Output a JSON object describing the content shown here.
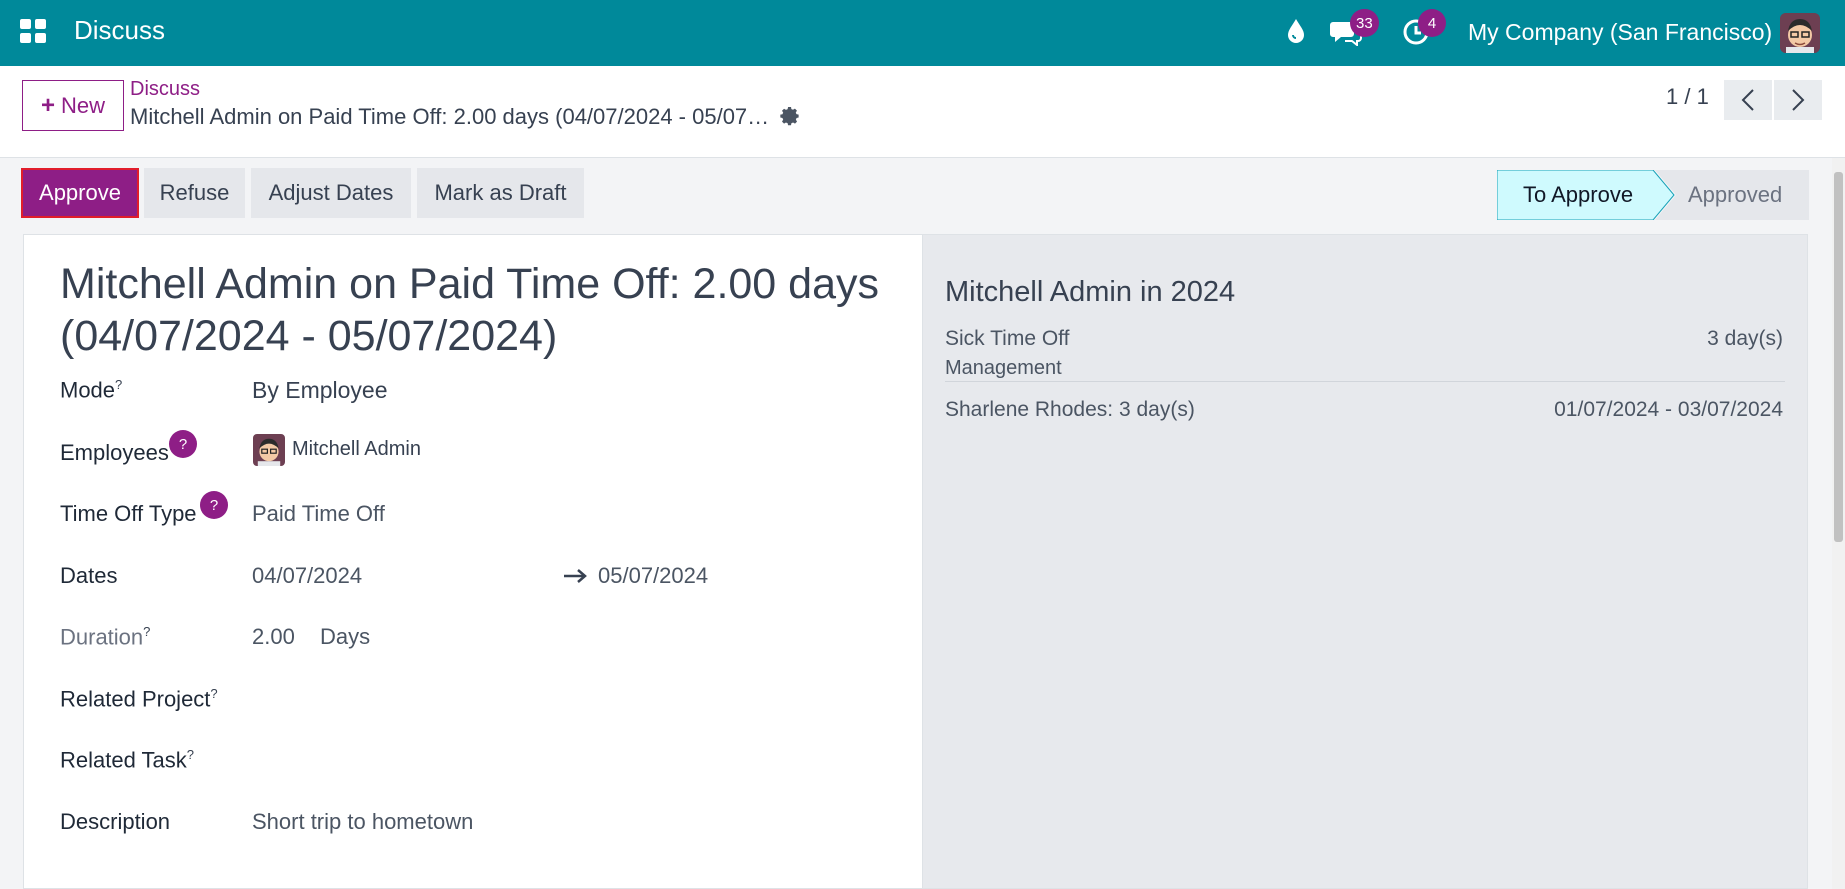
{
  "navbar": {
    "app_title": "Discuss",
    "messages_count": "33",
    "activities_count": "4",
    "company": "My Company (San Francisco)",
    "accent": "#00899a",
    "badge_color": "#8e1e86"
  },
  "control": {
    "new_label": "New",
    "breadcrumb_parent": "Discuss",
    "breadcrumb_current": "Mitchell Admin on Paid Time Off: 2.00 days (04/07/2024 - 05/07/2024)",
    "pager": "1 / 1"
  },
  "actions": {
    "approve": "Approve",
    "refuse": "Refuse",
    "adjust_dates": "Adjust Dates",
    "mark_draft": "Mark as Draft"
  },
  "stages": {
    "current": "To Approve",
    "next": "Approved"
  },
  "form": {
    "title": "Mitchell Admin on Paid Time Off: 2.00 days (04/07/2024 - 05/07/2024)",
    "mode_label": "Mode",
    "mode_value": "By Employee",
    "employees_label": "Employees",
    "employee_name": "Mitchell Admin",
    "type_label": "Time Off Type",
    "type_value": "Paid Time Off",
    "dates_label": "Dates",
    "date_from": "04/07/2024",
    "date_to": "05/07/2024",
    "duration_label": "Duration",
    "duration_value": "2.00",
    "duration_unit": "Days",
    "project_label": "Related Project",
    "task_label": "Related Task",
    "description_label": "Description",
    "description_value": "Short trip to hometown",
    "help_mark": "?",
    "sup_mark": "?"
  },
  "side": {
    "title": "Mitchell Admin in 2024",
    "leave_type": "Sick Time Off",
    "leave_days": "3 day(s)",
    "department": "Management",
    "entry_name": "Sharlene Rhodes: 3 day(s)",
    "entry_dates": "01/07/2024 - 03/07/2024"
  }
}
